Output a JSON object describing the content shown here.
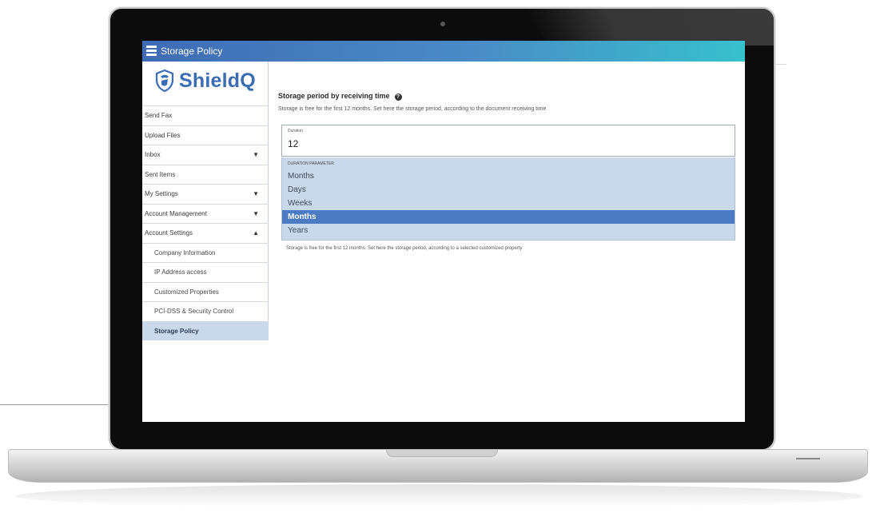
{
  "window": {
    "title": "Storage Policy"
  },
  "brand": {
    "name": "ShieldQ",
    "color": "#3b6db5"
  },
  "sidebar": {
    "items": [
      {
        "label": "Send Fax",
        "caret": ""
      },
      {
        "label": "Upload Files",
        "caret": ""
      },
      {
        "label": "Inbox",
        "caret": "▼"
      },
      {
        "label": "Sent Items",
        "caret": ""
      },
      {
        "label": "My Settings",
        "caret": "▼"
      },
      {
        "label": "Account Management",
        "caret": "▼"
      },
      {
        "label": "Account Settings",
        "caret": "▲"
      },
      {
        "label": "Company Information",
        "caret": ""
      },
      {
        "label": "IP Address access",
        "caret": ""
      },
      {
        "label": "Customized Properties",
        "caret": ""
      },
      {
        "label": "PCI-DSS & Security Control",
        "caret": ""
      },
      {
        "label": "Storage Policy",
        "caret": ""
      }
    ]
  },
  "main": {
    "section_title": "Storage period by receiving time",
    "help_icon": "?",
    "description": "Storage is free for the first 12 months. Set here the storage period, according to the document receiving time",
    "duration": {
      "label": "Duration",
      "value": "12"
    },
    "dropdown": {
      "header": "DURATION PARAMETER",
      "options": [
        "Months",
        "Days",
        "Weeks",
        "Months",
        "Years"
      ],
      "selected_index": 3
    },
    "note": "Storage is free for the first 12 months. Set here the storage period, according to a selected customized property"
  },
  "colors": {
    "topbar_start": "#3f6cb5",
    "topbar_end": "#37c0cd",
    "selected": "#4a7bc3",
    "dropdown_bg": "#c9d8ea"
  }
}
